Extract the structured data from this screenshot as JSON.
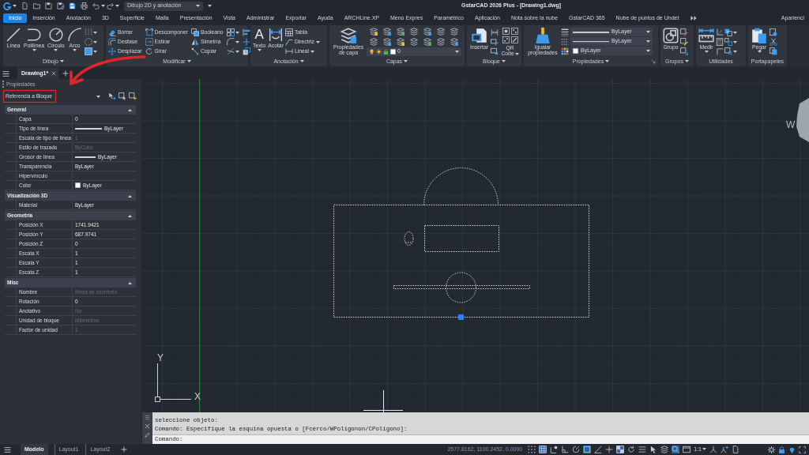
{
  "title_bar": {
    "workspace": "Dibujo 2D y anotación",
    "title": "GstarCAD 2026 Plus - [Drawing1.dwg]"
  },
  "menu_tabs": [
    {
      "label": "Inicio",
      "selected": true
    },
    {
      "label": "Inserción",
      "selected": false
    },
    {
      "label": "Anotación",
      "selected": false
    },
    {
      "label": "3D",
      "selected": false
    },
    {
      "label": "Superficie",
      "selected": false
    },
    {
      "label": "Malla",
      "selected": false
    },
    {
      "label": "Presentación",
      "selected": false
    },
    {
      "label": "Vista",
      "selected": false
    },
    {
      "label": "Administrar",
      "selected": false
    },
    {
      "label": "Exportar",
      "selected": false
    },
    {
      "label": "Ayuda",
      "selected": false
    },
    {
      "label": "ARCHLine.XP",
      "selected": false
    },
    {
      "label": "Menú Expres",
      "selected": false
    },
    {
      "label": "Paramétrico",
      "selected": false
    },
    {
      "label": "Aplicación",
      "selected": false
    },
    {
      "label": "Nota sobre la nube",
      "selected": false
    },
    {
      "label": "GstarCAD 365",
      "selected": false
    },
    {
      "label": "Nube de puntos de Undet",
      "selected": false
    }
  ],
  "appearance": "Aparienci",
  "ribbon": [
    {
      "kind": "draw",
      "title": "Dibujo",
      "buttons": [
        "Línea",
        "Polilínea",
        "Círculo",
        "Arco"
      ]
    },
    {
      "kind": "modify",
      "title": "Modificar",
      "buttons": [
        "Borrar",
        "Descomponer",
        "Booleano",
        "Desfase",
        "Estirar",
        "Simetría",
        "Desplazar",
        "Girar",
        "Copiar"
      ]
    },
    {
      "kind": "annotate",
      "title": "Anotación",
      "glyph": "A",
      "buttons": [
        "Texto",
        "Acotar",
        "Tabla",
        "Directriz",
        "Lineal"
      ]
    },
    {
      "kind": "layers",
      "title": "Capas",
      "buttons": [
        "Propiedades de capa"
      ],
      "fields": [
        "0"
      ]
    },
    {
      "kind": "block",
      "title": "Bloque",
      "buttons": [
        "Insertar",
        "QR Code"
      ]
    },
    {
      "kind": "properties",
      "title": "Propiedades",
      "buttons": [
        "Igualar propiedades"
      ],
      "fields": [
        "ByLayer",
        "ByLayer",
        "ByLayer"
      ]
    },
    {
      "kind": "groups",
      "title": "Grupos",
      "buttons": [
        "Grupo"
      ]
    },
    {
      "kind": "utilities",
      "title": "Utilidades",
      "buttons": [
        "Medir"
      ]
    },
    {
      "kind": "clipboard",
      "title": "Portapapeles",
      "buttons": [
        "Pegar"
      ]
    }
  ],
  "document_tabs": [
    {
      "label": "Drawing1*",
      "selected": true
    }
  ],
  "properties": {
    "title": "Propiedades",
    "selection": "Referencia a Bloque",
    "sections": [
      {
        "title": "General",
        "expanded": true,
        "rows": [
          {
            "name": "Capa",
            "value": "0",
            "kind": "text",
            "disabled": false
          },
          {
            "name": "Tipo de línea",
            "value": "ByLayer",
            "kind": "linetype",
            "disabled": false
          },
          {
            "name": "Escala de tipo de línea",
            "value": "1",
            "kind": "text",
            "disabled": true
          },
          {
            "name": "Estilo de trazado",
            "value": "ByColor",
            "kind": "text",
            "disabled": true
          },
          {
            "name": "Grosor de línea",
            "value": "ByLayer",
            "kind": "lineweight",
            "disabled": false
          },
          {
            "name": "Transparencia",
            "value": "ByLayer",
            "kind": "text",
            "disabled": false
          },
          {
            "name": "Hipervínculo",
            "kind": "text"
          },
          {
            "name": "Color",
            "value": "ByLayer",
            "kind": "color",
            "color": "#ffffff",
            "disabled": false
          }
        ]
      },
      {
        "title": "Visualización 3D",
        "expanded": true,
        "rows": [
          {
            "name": "Material",
            "value": "ByLayer",
            "kind": "text",
            "disabled": false
          }
        ]
      },
      {
        "title": "Geometría",
        "expanded": true,
        "rows": [
          {
            "name": "Posición X",
            "value": "1741.9421",
            "kind": "text",
            "disabled": false
          },
          {
            "name": "Posición Y",
            "value": "687.9741",
            "kind": "text",
            "disabled": false
          },
          {
            "name": "Posición Z",
            "value": "0",
            "kind": "text",
            "disabled": false
          },
          {
            "name": "Escala X",
            "value": "1",
            "kind": "text",
            "disabled": false
          },
          {
            "name": "Escala Y",
            "value": "1",
            "kind": "text",
            "disabled": false
          },
          {
            "name": "Escala Z",
            "value": "1",
            "kind": "text",
            "disabled": false
          }
        ]
      },
      {
        "title": "Misc",
        "expanded": true,
        "rows": [
          {
            "name": "Nombre",
            "value": "Mesa de escritorio",
            "kind": "text",
            "disabled": true
          },
          {
            "name": "Rotación",
            "value": "0",
            "kind": "text",
            "disabled": false
          },
          {
            "name": "Anotativo",
            "value": "No",
            "kind": "text",
            "disabled": true
          },
          {
            "name": "Unidad de bloque",
            "value": "Milímetros",
            "kind": "text",
            "disabled": true
          },
          {
            "name": "Factor de unidad",
            "value": "1",
            "kind": "text",
            "disabled": true
          }
        ]
      }
    ]
  },
  "canvas": {
    "ucs": {
      "x": "X",
      "y": "Y"
    },
    "view_cube": "W"
  },
  "command_line": {
    "history": [
      "seleccione objeto:",
      "Comando: Especifique la esquina opuesta o [Fcerco/WPolígonon/CPolígono]:"
    ],
    "prompt": "Comando:"
  },
  "layout_tabs": [
    {
      "label": "Modelo",
      "selected": true
    },
    {
      "label": "Layout1",
      "selected": false
    },
    {
      "label": "Layout2",
      "selected": false
    }
  ],
  "status_bar": {
    "coordinates": "2577.8162, 1100.2452, 0.0000",
    "scale": "1:1",
    "toggles": [
      {
        "on": false
      },
      {
        "on": true
      },
      {
        "on": false
      },
      {
        "on": false
      },
      {
        "on": false
      },
      {
        "on": true
      },
      {
        "on": false
      },
      {
        "on": false
      },
      {
        "on": true
      },
      {
        "on": false
      },
      {
        "on": false
      },
      {
        "on": false
      },
      {
        "on": false
      },
      {
        "on": true
      },
      {
        "on": false
      },
      {
        "on": false
      },
      {
        "on": false
      },
      {
        "on": false
      }
    ]
  }
}
